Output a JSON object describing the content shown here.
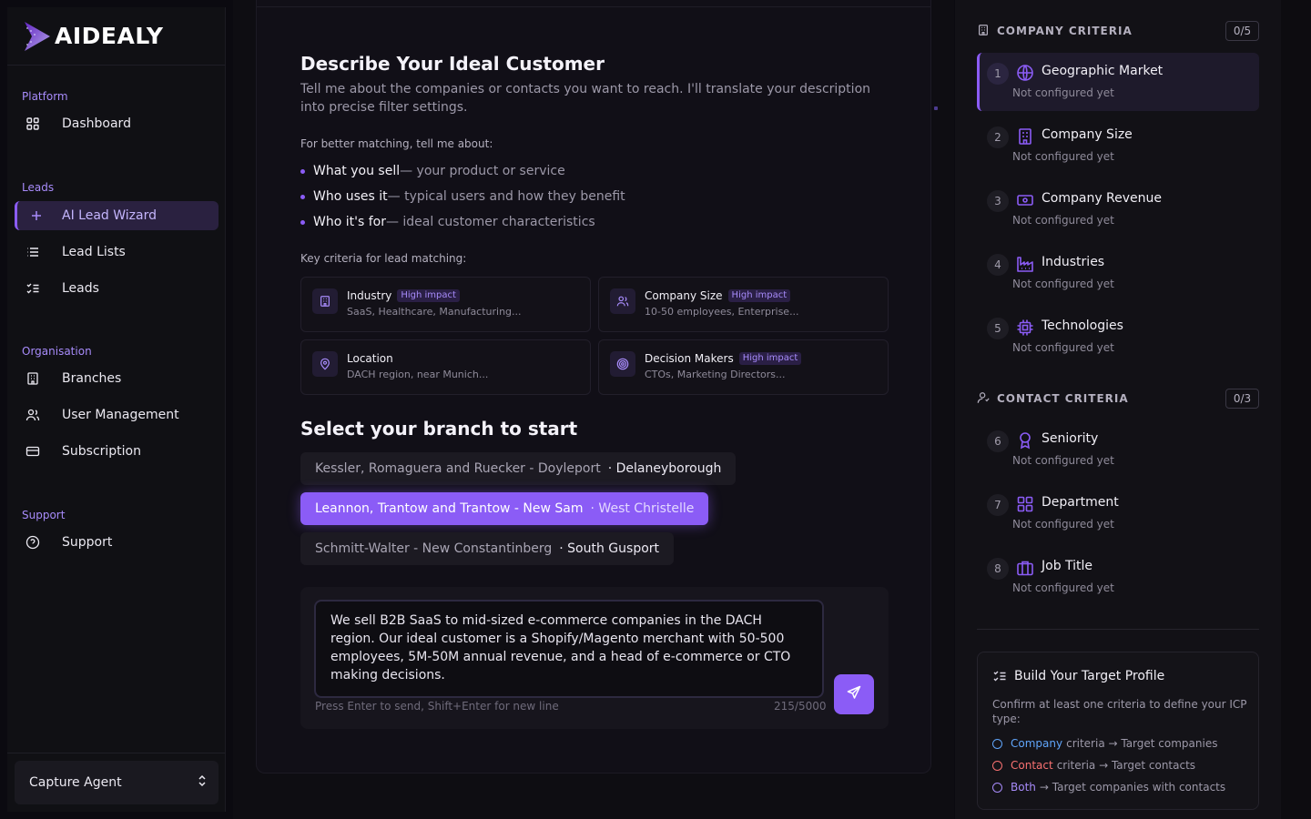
{
  "brand": {
    "name": "AIDEALY"
  },
  "sidebar": {
    "sections": [
      {
        "label": "Platform",
        "items": [
          {
            "label": "Dashboard",
            "icon": "grid-icon"
          }
        ]
      },
      {
        "label": "Leads",
        "items": [
          {
            "label": "AI Lead Wizard",
            "icon": "plus-icon",
            "active": true
          },
          {
            "label": "Lead Lists",
            "icon": "list-icon"
          },
          {
            "label": "Leads",
            "icon": "checklist-icon"
          }
        ]
      },
      {
        "label": "Organisation",
        "items": [
          {
            "label": "Branches",
            "icon": "building-icon"
          },
          {
            "label": "User Management",
            "icon": "users-icon"
          },
          {
            "label": "Subscription",
            "icon": "card-icon"
          }
        ]
      },
      {
        "label": "Support",
        "items": [
          {
            "label": "Support",
            "icon": "help-circle-icon"
          }
        ]
      }
    ],
    "capture_agent": "Capture Agent"
  },
  "main": {
    "title": "Describe Your Ideal Customer",
    "subtitle": "Tell me about the companies or contacts you want to reach. I'll translate your description into precise filter settings.",
    "better_label": "For better matching, tell me about:",
    "bullets": [
      {
        "bold": "What you sell",
        "rest": "— your product or service"
      },
      {
        "bold": "Who uses it",
        "rest": "— typical users and how they benefit"
      },
      {
        "bold": "Who it's for",
        "rest": "— ideal customer characteristics"
      }
    ],
    "key_label": "Key criteria for lead matching:",
    "criteria": [
      {
        "title": "Industry",
        "badge": "High impact",
        "desc": "SaaS, Healthcare, Manufacturing...",
        "icon": "building-icon"
      },
      {
        "title": "Company Size",
        "badge": "High impact",
        "desc": "10-50 employees, Enterprise...",
        "icon": "users-icon"
      },
      {
        "title": "Location",
        "badge": "",
        "desc": "DACH region, near Munich...",
        "icon": "map-pin-icon"
      },
      {
        "title": "Decision Makers",
        "badge": "High impact",
        "desc": "CTOs, Marketing Directors...",
        "icon": "target-icon"
      }
    ],
    "branch_title": "Select your branch to start",
    "branches": [
      {
        "name": "Kessler, Romaguera and Ruecker - Doyleport",
        "city": "· Delaneyborough",
        "selected": false
      },
      {
        "name": "Leannon, Trantow and Trantow - New Sam",
        "city": "· West Christelle",
        "selected": true
      },
      {
        "name": "Schmitt-Walter - New Constantinberg",
        "city": "· South Gusport",
        "selected": false
      }
    ],
    "chat": {
      "value": "We sell B2B SaaS to mid-sized e-commerce companies in the DACH region. Our ideal customer is a Shopify/Magento merchant with 50-500 employees, 5M-50M annual revenue, and a head of e-commerce or CTO making decisions.",
      "hint": "Press Enter to send, Shift+Enter for new line",
      "count": "215/5000"
    }
  },
  "right": {
    "company": {
      "title": "COMPANY CRITERIA",
      "count": "0/5",
      "steps": [
        {
          "num": "1",
          "title": "Geographic Market",
          "sub": "Not configured yet",
          "icon": "globe-icon"
        },
        {
          "num": "2",
          "title": "Company Size",
          "sub": "Not configured yet",
          "icon": "building-icon"
        },
        {
          "num": "3",
          "title": "Company Revenue",
          "sub": "Not configured yet",
          "icon": "banknote-icon"
        },
        {
          "num": "4",
          "title": "Industries",
          "sub": "Not configured yet",
          "icon": "factory-icon"
        },
        {
          "num": "5",
          "title": "Technologies",
          "sub": "Not configured yet",
          "icon": "cpu-icon"
        }
      ]
    },
    "contact": {
      "title": "CONTACT CRITERIA",
      "count": "0/3",
      "steps": [
        {
          "num": "6",
          "title": "Seniority",
          "sub": "Not configured yet",
          "icon": "award-icon"
        },
        {
          "num": "7",
          "title": "Department",
          "sub": "Not configured yet",
          "icon": "grid-icon"
        },
        {
          "num": "8",
          "title": "Job Title",
          "sub": "Not configured yet",
          "icon": "briefcase-icon"
        }
      ]
    },
    "profile": {
      "title": "Build Your Target Profile",
      "desc": "Confirm at least one criteria to define your ICP type:",
      "options": [
        {
          "kw": "Company",
          "rest": "criteria → Target companies",
          "color": "#60a5fa"
        },
        {
          "kw": "Contact",
          "rest": "criteria → Target contacts",
          "color": "#f87171"
        },
        {
          "kw": "Both",
          "rest": "→ Target companies with contacts",
          "color": "#a78bfa"
        }
      ]
    }
  }
}
